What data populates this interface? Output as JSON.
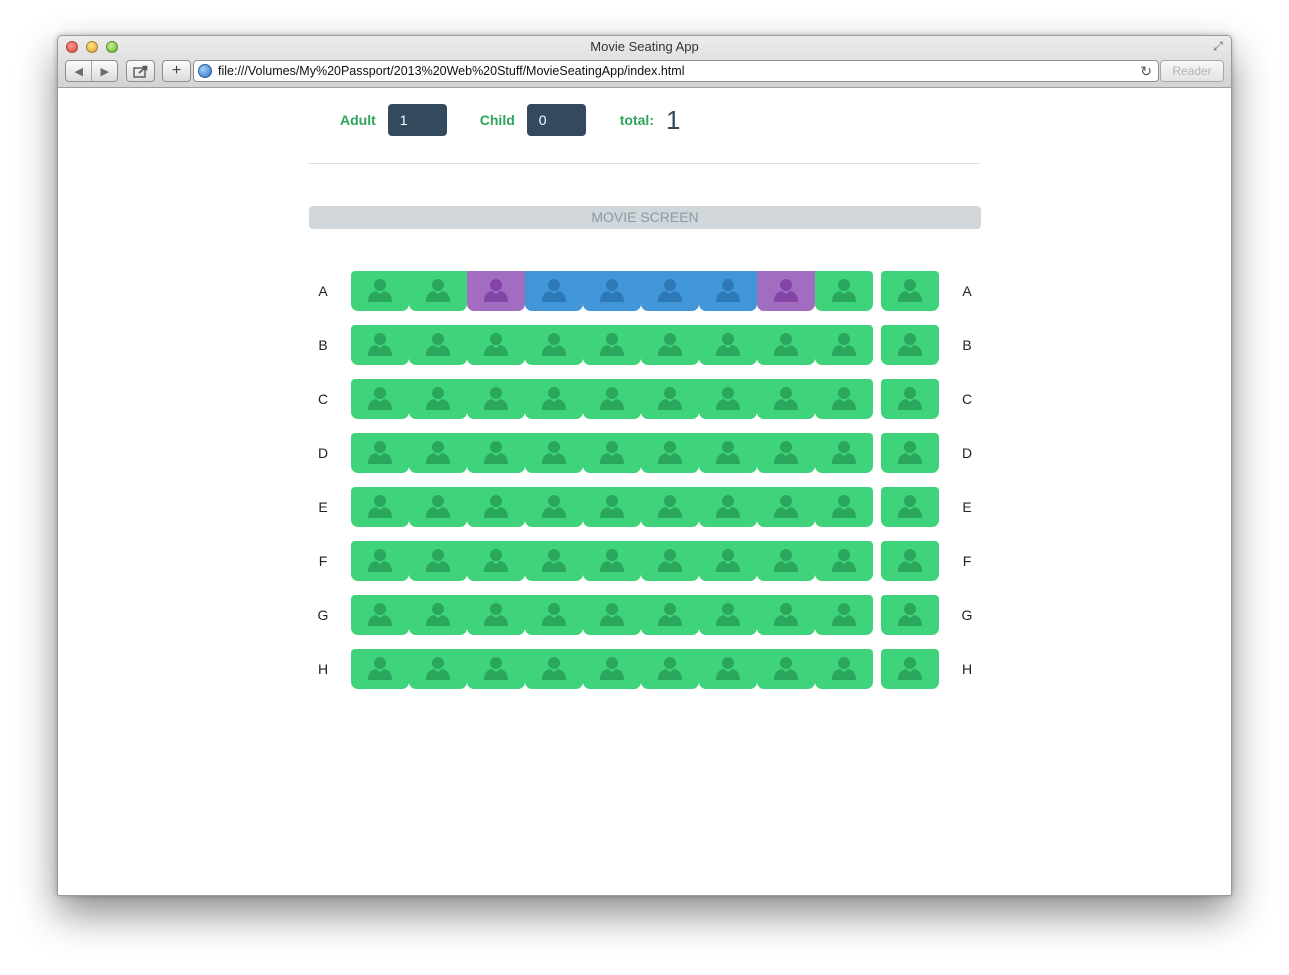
{
  "window": {
    "title": "Movie Seating App"
  },
  "browser": {
    "url": "file:///Volumes/My%20Passport/2013%20Web%20Stuff/MovieSeatingApp/index.html",
    "reader_label": "Reader"
  },
  "tickets": {
    "adult_label": "Adult",
    "adult_value": "1",
    "child_label": "Child",
    "child_value": "0",
    "total_label": "total:",
    "total_value": "1"
  },
  "screen_label": "MOVIE SCREEN",
  "seat_legend": {
    "available": "#3fd37b",
    "selected": "#4196d9",
    "taken": "#a26cc0"
  },
  "rows": [
    {
      "label": "A",
      "seats": [
        "available",
        "available",
        "taken",
        "selected",
        "selected",
        "selected",
        "selected",
        "taken",
        "available"
      ],
      "aisle_seat": "available"
    },
    {
      "label": "B",
      "seats": [
        "available",
        "available",
        "available",
        "available",
        "available",
        "available",
        "available",
        "available",
        "available"
      ],
      "aisle_seat": "available"
    },
    {
      "label": "C",
      "seats": [
        "available",
        "available",
        "available",
        "available",
        "available",
        "available",
        "available",
        "available",
        "available"
      ],
      "aisle_seat": "available"
    },
    {
      "label": "D",
      "seats": [
        "available",
        "available",
        "available",
        "available",
        "available",
        "available",
        "available",
        "available",
        "available"
      ],
      "aisle_seat": "available"
    },
    {
      "label": "E",
      "seats": [
        "available",
        "available",
        "available",
        "available",
        "available",
        "available",
        "available",
        "available",
        "available"
      ],
      "aisle_seat": "available"
    },
    {
      "label": "F",
      "seats": [
        "available",
        "available",
        "available",
        "available",
        "available",
        "available",
        "available",
        "available",
        "available"
      ],
      "aisle_seat": "available"
    },
    {
      "label": "G",
      "seats": [
        "available",
        "available",
        "available",
        "available",
        "available",
        "available",
        "available",
        "available",
        "available"
      ],
      "aisle_seat": "available"
    },
    {
      "label": "H",
      "seats": [
        "available",
        "available",
        "available",
        "available",
        "available",
        "available",
        "available",
        "available",
        "available"
      ],
      "aisle_seat": "available"
    }
  ]
}
